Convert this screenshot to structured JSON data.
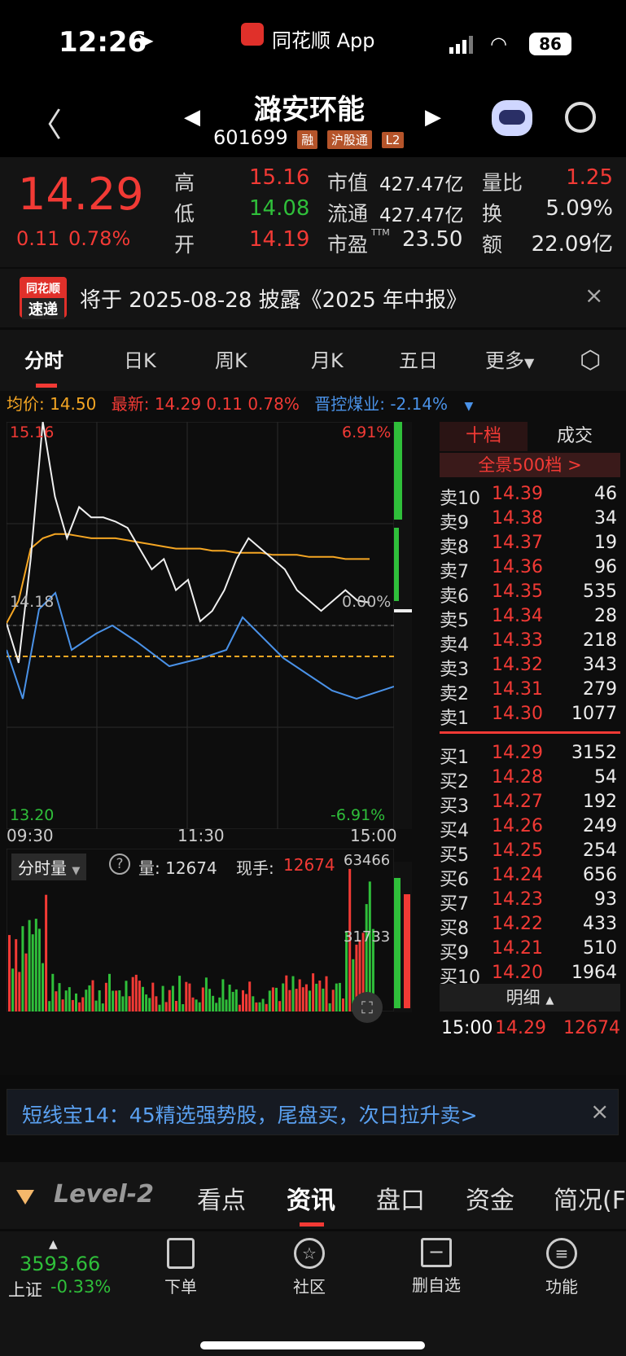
{
  "status_bar": {
    "time": "12:26",
    "app": "同花顺 App",
    "battery": "86"
  },
  "header": {
    "name": "潞安环能",
    "code": "601699",
    "tags": [
      "融",
      "沪股通",
      "L2"
    ]
  },
  "quote": {
    "price": "14.29",
    "change": "0.11",
    "change_pct": "0.78%",
    "rows": [
      {
        "l1": "高",
        "v1": "15.16",
        "l2": "市值",
        "v2": "427.47亿",
        "l3": "量比",
        "v3": "1.25"
      },
      {
        "l1": "低",
        "v1": "14.08",
        "l2": "流通",
        "v2": "427.47亿",
        "l3": "换",
        "v3": "5.09%"
      },
      {
        "l1": "开",
        "v1": "14.19",
        "l2": "市盈",
        "v2": "23.50",
        "l3": "额",
        "v3": "22.09亿"
      }
    ],
    "ttm": "TTM"
  },
  "notice": {
    "logo_top": "同花顺",
    "logo_bottom": "速递",
    "text": "将于 2025-08-28 披露《2025 年中报》"
  },
  "tabs": [
    "分时",
    "日K",
    "周K",
    "月K",
    "五日",
    "更多"
  ],
  "info_line": {
    "avg_label": "均价: 14.50",
    "latest": "最新: 14.29  0.11  0.78%",
    "sector": "晋控煤业: -2.14%"
  },
  "chart_data": {
    "type": "line",
    "x_ticks": [
      "09:30",
      "11:30",
      "15:00"
    ],
    "ylim": [
      13.2,
      15.16
    ],
    "y_left_labels": {
      "top": "15.16",
      "mid": "14.18",
      "bottom": "13.20"
    },
    "y_right_labels": {
      "top": "6.91%",
      "mid": "0.00%",
      "bottom": "-6.91%"
    },
    "series": [
      {
        "values": [
          14.19,
          14.0,
          14.5,
          15.16,
          14.8,
          14.6,
          14.75,
          14.7,
          14.7,
          14.68,
          14.65,
          14.55,
          14.45,
          14.5,
          14.35,
          14.4,
          14.2,
          14.25,
          14.35,
          14.5,
          14.6,
          14.55,
          14.5,
          14.45,
          14.35,
          14.3,
          14.25,
          14.3,
          14.35,
          14.3,
          14.29
        ]
      },
      {
        "values": [
          14.19,
          14.3,
          14.55,
          14.6,
          14.62,
          14.62,
          14.61,
          14.6,
          14.6,
          14.6,
          14.59,
          14.58,
          14.57,
          14.56,
          14.55,
          14.55,
          14.55,
          14.54,
          14.54,
          14.53,
          14.53,
          14.53,
          14.52,
          14.52,
          14.52,
          14.51,
          14.51,
          14.51,
          14.5,
          14.5,
          14.5
        ]
      }
    ],
    "volume": {
      "label": "分时量",
      "vol_text": "量: 12674",
      "hand_label": "现手:",
      "hand_value": "12674",
      "ticks": [
        "63466",
        "31733"
      ]
    }
  },
  "orderbook": {
    "tab_active": "十档",
    "tab_other": "成交",
    "panorama": "全景500档 >",
    "asks": [
      {
        "label": "卖10",
        "price": "14.39",
        "vol": "46"
      },
      {
        "label": "卖9",
        "price": "14.38",
        "vol": "34"
      },
      {
        "label": "卖8",
        "price": "14.37",
        "vol": "19"
      },
      {
        "label": "卖7",
        "price": "14.36",
        "vol": "96"
      },
      {
        "label": "卖6",
        "price": "14.35",
        "vol": "535"
      },
      {
        "label": "卖5",
        "price": "14.34",
        "vol": "28"
      },
      {
        "label": "卖4",
        "price": "14.33",
        "vol": "218"
      },
      {
        "label": "卖3",
        "price": "14.32",
        "vol": "343"
      },
      {
        "label": "卖2",
        "price": "14.31",
        "vol": "279"
      },
      {
        "label": "卖1",
        "price": "14.30",
        "vol": "1077"
      }
    ],
    "bids": [
      {
        "label": "买1",
        "price": "14.29",
        "vol": "3152"
      },
      {
        "label": "买2",
        "price": "14.28",
        "vol": "54"
      },
      {
        "label": "买3",
        "price": "14.27",
        "vol": "192"
      },
      {
        "label": "买4",
        "price": "14.26",
        "vol": "249"
      },
      {
        "label": "买5",
        "price": "14.25",
        "vol": "254"
      },
      {
        "label": "买6",
        "price": "14.24",
        "vol": "656"
      },
      {
        "label": "买7",
        "price": "14.23",
        "vol": "93"
      },
      {
        "label": "买8",
        "price": "14.22",
        "vol": "433"
      },
      {
        "label": "买9",
        "price": "14.21",
        "vol": "510"
      },
      {
        "label": "买10",
        "price": "14.20",
        "vol": "1964"
      }
    ],
    "detail_label": "明细",
    "last_trade": {
      "time": "15:00",
      "price": "14.29",
      "vol": "12674"
    }
  },
  "promo": {
    "text": "短线宝14：45精选强势股，尾盘买，次日拉升卖>"
  },
  "subtabs": {
    "level2": "Level-2",
    "items": [
      "看点",
      "资讯",
      "盘口",
      "资金",
      "简况(F"
    ]
  },
  "bottom": {
    "index_value": "3593.66",
    "index_name": "上证",
    "index_change": "-0.33%",
    "items": [
      {
        "icon": "document-icon",
        "label": "下单"
      },
      {
        "icon": "star-icon",
        "label": "社区"
      },
      {
        "icon": "minus-box-icon",
        "label": "删自选"
      },
      {
        "icon": "menu-icon",
        "label": "功能"
      }
    ]
  },
  "colors": {
    "up": "#f23a35",
    "down": "#2fbf3a",
    "avg": "#f5a623",
    "sector": "#4a92e8"
  }
}
